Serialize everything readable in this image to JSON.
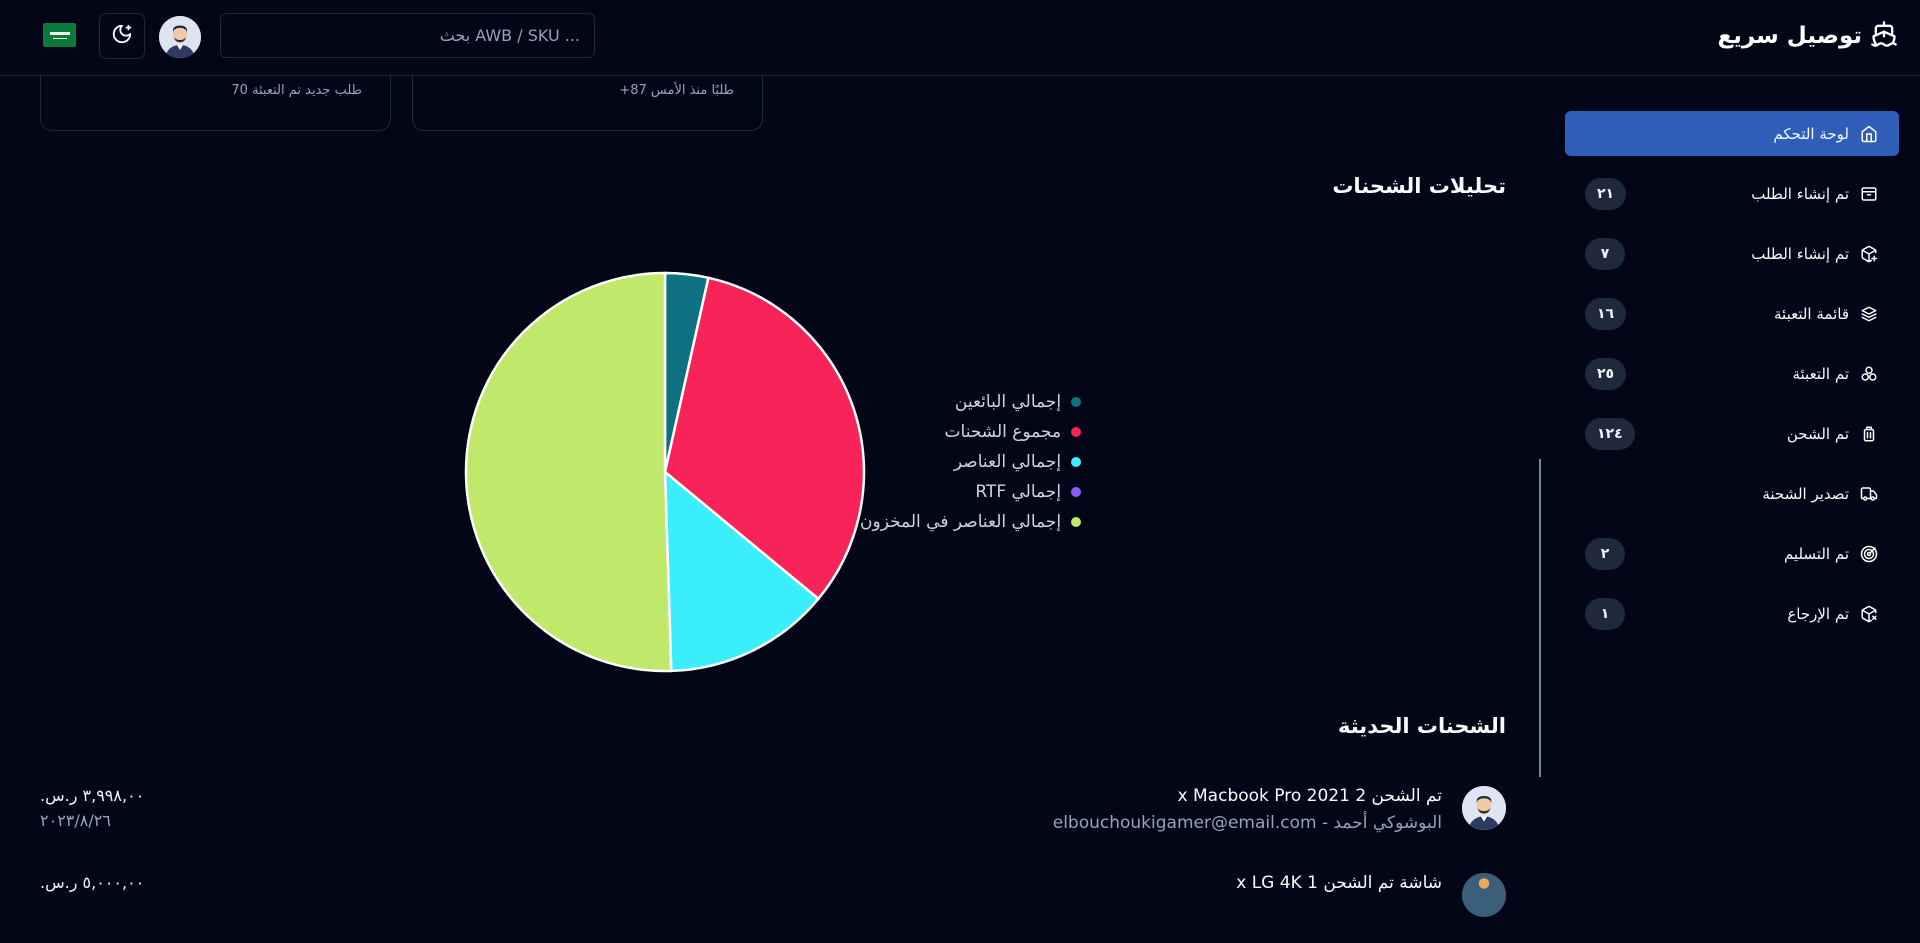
{
  "header": {
    "brand_name": "توصيل سريع",
    "search_placeholder": "بحث AWB / SKU ...",
    "flag_text": "SA"
  },
  "sidebar": {
    "items": [
      {
        "label": "لوحة التحكم",
        "icon": "home-icon",
        "badge": "",
        "active": true
      },
      {
        "label": "تم إنشاء الطلب",
        "icon": "package-icon",
        "badge": "٢١",
        "active": false
      },
      {
        "label": "تم إنشاء الطلب",
        "icon": "package-plus-icon",
        "badge": "٧",
        "active": false
      },
      {
        "label": "قائمة التعبئة",
        "icon": "boxes-icon",
        "badge": "١٦",
        "active": false
      },
      {
        "label": "تم التعبئة",
        "icon": "stacked-boxes-icon",
        "badge": "٢٥",
        "active": false
      },
      {
        "label": "تم الشحن",
        "icon": "luggage-icon",
        "badge": "١٢٤",
        "active": false
      },
      {
        "label": "تصدير الشحنة",
        "icon": "truck-icon",
        "badge": "",
        "active": false
      },
      {
        "label": "تم التسليم",
        "icon": "target-icon",
        "badge": "٢",
        "active": false
      },
      {
        "label": "تم الإرجاع",
        "icon": "package-x-icon",
        "badge": "١",
        "active": false
      }
    ]
  },
  "cards": [
    {
      "subtitle": "طلبًا منذ الأمس 87+"
    },
    {
      "subtitle": "طلب جديد تم التعبئة 70"
    }
  ],
  "analytics": {
    "title": "تحليلات الشحنات"
  },
  "chart_data": {
    "type": "pie",
    "categories": [
      "إجمالي البائعين",
      "مجموع الشحنات",
      "إجمالي العناصر",
      "إجمالي RTF",
      "إجمالي العناصر في المخزون"
    ],
    "values": [
      3.5,
      32.5,
      13.5,
      0,
      50.5
    ],
    "colors": [
      "#0e7282",
      "#f72359",
      "#3aeefc",
      "#8b5cf6",
      "#c0e86a"
    ],
    "legend_position": "right"
  },
  "recent": {
    "title": "الشحنات الحديثة",
    "items": [
      {
        "title": "تم الشحن 2 x Macbook Pro 2021",
        "subtitle": "البوشوكي أحمد - elbouchoukigamer@email.com",
        "amount": "٣,٩٩٨,٠٠ ر.س.",
        "date": "٢٠٢٣/٨/٢٦"
      },
      {
        "title": "شاشة تم الشحن 1 x LG 4K",
        "subtitle": "",
        "amount": "٥,٠٠٠,٠٠ ر.س.",
        "date": ""
      }
    ]
  }
}
